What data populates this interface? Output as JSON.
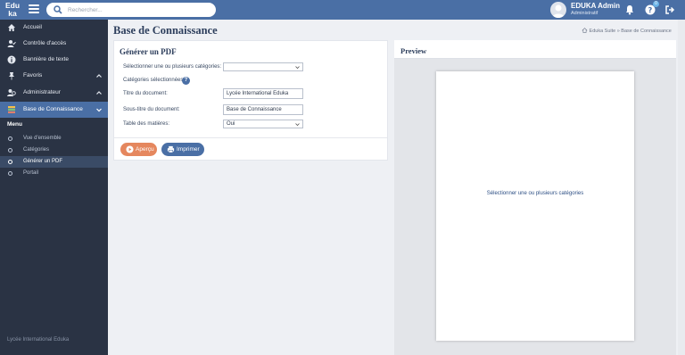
{
  "topbar": {
    "logo_line1": "Edu",
    "logo_line2": "ka",
    "search_placeholder": "Rechercher...",
    "user_name": "EDUKA Admin",
    "user_role": "Administratif",
    "notification_badge": "0",
    "accent": "#4a6fa5"
  },
  "sidebar": {
    "items": [
      {
        "label": "Accueil",
        "icon": "home-icon"
      },
      {
        "label": "Contrôle d'accès",
        "icon": "user-check-icon"
      },
      {
        "label": "Bannière de texte",
        "icon": "info-icon"
      },
      {
        "label": "Favoris",
        "icon": "pin-icon"
      },
      {
        "label": "Administrateur",
        "icon": "users-icon"
      },
      {
        "label": "Base de Connaissance",
        "icon": "books-icon"
      }
    ],
    "menu_heading": "Menu",
    "sub_items": [
      {
        "label": "Vue d'ensemble"
      },
      {
        "label": "Catégories"
      },
      {
        "label": "Générer un PDF"
      },
      {
        "label": "Portail"
      }
    ],
    "footer": "Lycée International Eduka"
  },
  "page": {
    "title": "Base de Connaissance",
    "breadcrumb": "Eduka Suite » Base de Connaissance"
  },
  "form": {
    "title": "Générer un PDF",
    "categories_label": "Sélectionner une ou plusieurs catégories:",
    "categories_value": "",
    "selected_label": "Catégories sélectionnées",
    "doc_title_label": "Titre du document:",
    "doc_title_value": "Lycée International Eduka",
    "subtitle_label": "Sous-titre du document:",
    "subtitle_value": "Base de Connaissance",
    "toc_label": "Table des matières:",
    "toc_value": "Oui",
    "preview_button": "Aperçu",
    "print_button": "Imprimer",
    "preview_button_color": "#e5875e"
  },
  "preview": {
    "title": "Preview",
    "message": "Sélectionner une ou plusieurs catégories"
  }
}
